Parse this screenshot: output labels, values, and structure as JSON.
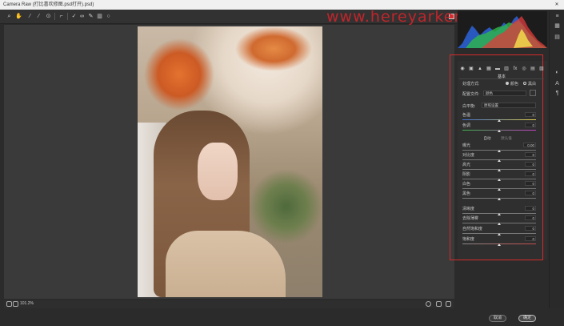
{
  "window": {
    "title": "Camera Raw (打比喜欢修图.psd打开).psd)"
  },
  "watermark": "www.hereyarker.com",
  "statusbar": {
    "zoom": "101.2%"
  },
  "buttons": {
    "cancel": "取消",
    "ok": "确定"
  },
  "panel": {
    "title": "基本",
    "treatment_label": "处理方式:",
    "color_option": "颜色",
    "bw_option": "黑白",
    "profile_label": "配置文件:",
    "profile_value": "颜色",
    "wb_label": "白平衡:",
    "wb_value": "原照设置",
    "auto_label": "自动",
    "default_label": "默认值",
    "sliders": [
      {
        "label": "色温",
        "value": "0"
      },
      {
        "label": "色调",
        "value": "0"
      },
      {
        "label": "曝光",
        "value": "0.00"
      },
      {
        "label": "对比度",
        "value": "0"
      },
      {
        "label": "高光",
        "value": "0"
      },
      {
        "label": "阴影",
        "value": "0"
      },
      {
        "label": "白色",
        "value": "0"
      },
      {
        "label": "黑色",
        "value": "0"
      },
      {
        "label": "清晰度",
        "value": "0"
      },
      {
        "label": "去除薄雾",
        "value": "0"
      },
      {
        "label": "自然饱和度",
        "value": "0"
      },
      {
        "label": "饱和度",
        "value": "0"
      }
    ]
  }
}
